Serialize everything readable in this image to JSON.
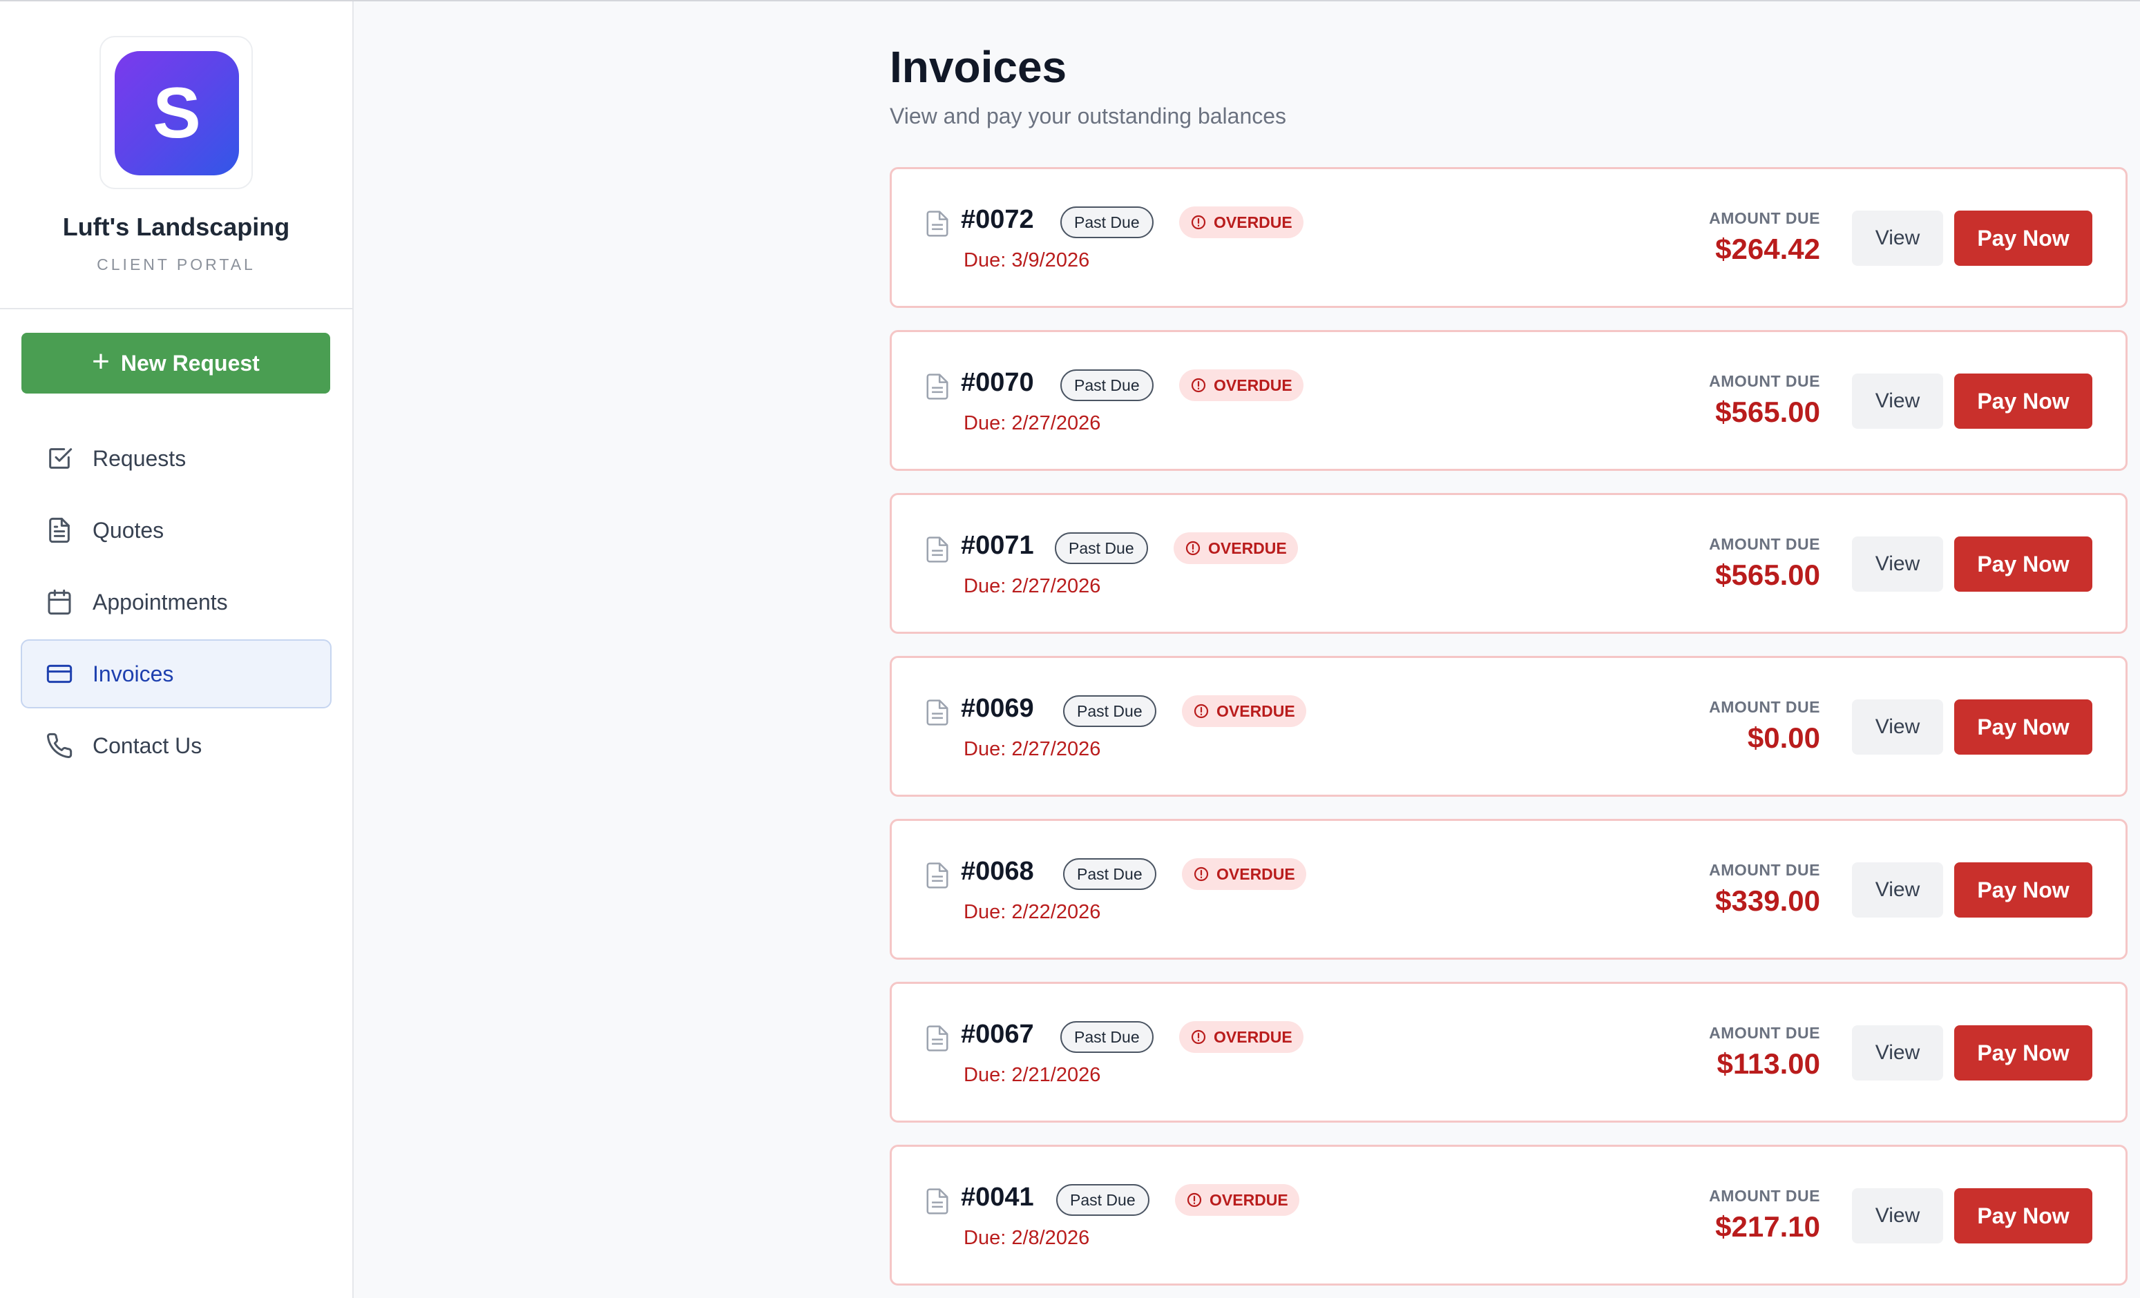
{
  "brand": {
    "logo_letter": "S",
    "name": "Luft's Landscaping",
    "subtitle": "CLIENT PORTAL"
  },
  "sidebar": {
    "new_request_label": "New Request",
    "items": [
      {
        "label": "Requests",
        "icon": "checkbox-icon"
      },
      {
        "label": "Quotes",
        "icon": "document-icon"
      },
      {
        "label": "Appointments",
        "icon": "calendar-icon"
      },
      {
        "label": "Invoices",
        "icon": "credit-card-icon",
        "active": true
      },
      {
        "label": "Contact Us",
        "icon": "phone-icon"
      }
    ]
  },
  "main": {
    "title": "Invoices",
    "subtitle": "View and pay your outstanding balances",
    "amount_label": "AMOUNT DUE",
    "view_label": "View",
    "pay_label": "Pay Now",
    "past_due_label": "Past Due",
    "overdue_label": "OVERDUE",
    "invoices": [
      {
        "number": "#0072",
        "due": "Due: 3/9/2026",
        "amount": "$264.42"
      },
      {
        "number": "#0070",
        "due": "Due: 2/27/2026",
        "amount": "$565.00"
      },
      {
        "number": "#0071",
        "due": "Due: 2/27/2026",
        "amount": "$565.00"
      },
      {
        "number": "#0069",
        "due": "Due: 2/27/2026",
        "amount": "$0.00"
      },
      {
        "number": "#0068",
        "due": "Due: 2/22/2026",
        "amount": "$339.00"
      },
      {
        "number": "#0067",
        "due": "Due: 2/21/2026",
        "amount": "$113.00"
      },
      {
        "number": "#0041",
        "due": "Due: 2/8/2026",
        "amount": "$217.10"
      }
    ]
  },
  "colors": {
    "accent_green": "#4a9e52",
    "danger_red": "#c9302c",
    "active_blue": "#1e40af"
  }
}
